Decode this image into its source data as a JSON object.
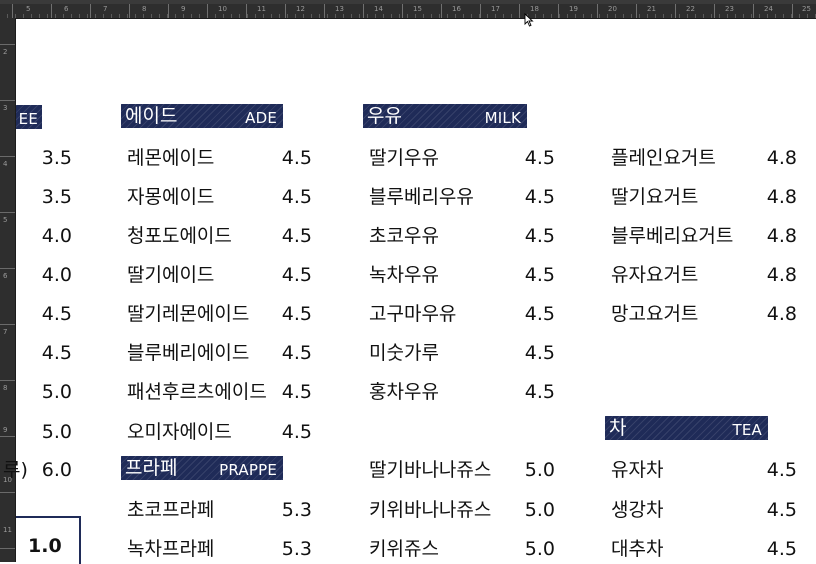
{
  "ruler": {
    "h_numbers": [
      "5",
      "6",
      "7",
      "8",
      "9",
      "10",
      "11",
      "12",
      "13",
      "14",
      "15",
      "16",
      "17",
      "18",
      "19",
      "20",
      "21",
      "22",
      "23",
      "24",
      "25"
    ],
    "v_numbers": [
      "2",
      "3",
      "4",
      "5",
      "6",
      "7",
      "8",
      "9",
      "10",
      "11"
    ]
  },
  "sections": {
    "coffee": {
      "header_en": "EE",
      "prices": [
        "3.5",
        "3.5",
        "4.0",
        "4.0",
        "4.5",
        "4.5",
        "5.0",
        "5.0",
        "6.0"
      ],
      "partial_label": "루)"
    },
    "ade": {
      "header_kr": "에이드",
      "header_en": "ADE",
      "items": [
        {
          "name": "레몬에이드",
          "price": "4.5"
        },
        {
          "name": "자몽에이드",
          "price": "4.5"
        },
        {
          "name": "청포도에이드",
          "price": "4.5"
        },
        {
          "name": "딸기에이드",
          "price": "4.5"
        },
        {
          "name": "딸기레몬에이드",
          "price": "4.5"
        },
        {
          "name": "블루베리에이드",
          "price": "4.5"
        },
        {
          "name": "패션후르츠에이드",
          "price": "4.5"
        },
        {
          "name": "오미자에이드",
          "price": "4.5"
        }
      ]
    },
    "frappe": {
      "header_kr": "프라페",
      "header_en": "PRAPPE",
      "items": [
        {
          "name": "초코프라페",
          "price": "5.3"
        },
        {
          "name": "녹차프라페",
          "price": "5.3"
        }
      ]
    },
    "milk": {
      "header_kr": "우유",
      "header_en": "MILK",
      "items": [
        {
          "name": "딸기우유",
          "price": "4.5"
        },
        {
          "name": "블루베리우유",
          "price": "4.5"
        },
        {
          "name": "초코우유",
          "price": "4.5"
        },
        {
          "name": "녹차우유",
          "price": "4.5"
        },
        {
          "name": "고구마우유",
          "price": "4.5"
        },
        {
          "name": "미숫가루",
          "price": "4.5"
        },
        {
          "name": "홍차우유",
          "price": "4.5"
        }
      ]
    },
    "juice": {
      "items": [
        {
          "name": "딸기바나나쥬스",
          "price": "5.0"
        },
        {
          "name": "키위바나나쥬스",
          "price": "5.0"
        },
        {
          "name": "키위쥬스",
          "price": "5.0"
        }
      ]
    },
    "yogurt": {
      "items": [
        {
          "name": "플레인요거트",
          "price": "4.8"
        },
        {
          "name": "딸기요거트",
          "price": "4.8"
        },
        {
          "name": "블루베리요거트",
          "price": "4.8"
        },
        {
          "name": "유자요거트",
          "price": "4.8"
        },
        {
          "name": "망고요거트",
          "price": "4.8"
        }
      ]
    },
    "tea": {
      "header_kr": "차",
      "header_en": "TEA",
      "items": [
        {
          "name": "유자차",
          "price": "4.5"
        },
        {
          "name": "생강차",
          "price": "4.5"
        },
        {
          "name": "대추차",
          "price": "4.5"
        }
      ]
    }
  },
  "bottom_box": {
    "value": "1.0"
  },
  "colors": {
    "header_bg": "#1f2b58",
    "header_text": "#ffffff",
    "ruler_bg": "#2e2e2e"
  }
}
